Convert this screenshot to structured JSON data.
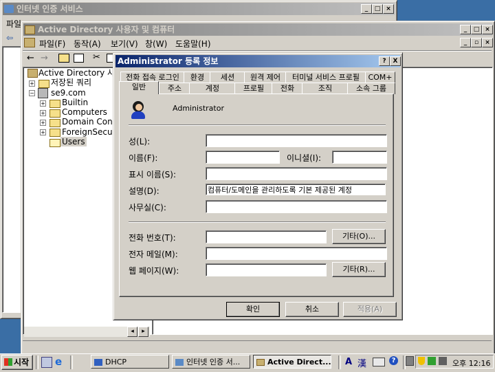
{
  "bg_window": {
    "title": "인터넷 인증 서비스",
    "menu_visible": "파일"
  },
  "main_window": {
    "title": "Active Directory 사용자 및 컴퓨터",
    "menu": [
      "파일(F)",
      "동작(A)",
      "보기(V)",
      "창(W)",
      "도움말(H)"
    ]
  },
  "tree": {
    "root": "Active Directory 사용자",
    "items": [
      "저장된 쿼리",
      "se9.com",
      "Builtin",
      "Computers",
      "Domain Contro",
      "ForeignSecurit",
      "Users"
    ]
  },
  "dialog": {
    "title": "Administrator 등록 정보",
    "help_btn": "?",
    "close_btn": "X",
    "tabs_back": [
      "전화 접속 로그인",
      "환경",
      "세션",
      "원격 제어",
      "터미널 서비스 프로필",
      "COM+"
    ],
    "tabs_front": [
      "일반",
      "주소",
      "계정",
      "프로필",
      "전화",
      "조직",
      "소속 그룹"
    ],
    "user_name": "Administrator",
    "fields": {
      "last_name": {
        "label": "성(L):",
        "value": ""
      },
      "first_name": {
        "label": "이름(F):",
        "value": ""
      },
      "initials": {
        "label": "이니셜(I):",
        "value": ""
      },
      "display_name": {
        "label": "표시 이름(S):",
        "value": ""
      },
      "description": {
        "label": "설명(D):",
        "value": "컴퓨터/도메인을 관리하도록 기본 제공된 계정"
      },
      "office": {
        "label": "사무실(C):",
        "value": ""
      },
      "phone": {
        "label": "전화 번호(T):",
        "value": ""
      },
      "email": {
        "label": "전자 메일(M):",
        "value": ""
      },
      "webpage": {
        "label": "웹 페이지(W):",
        "value": ""
      }
    },
    "other_btn_1": "기타(O)...",
    "other_btn_2": "기타(R)...",
    "ok": "확인",
    "cancel": "취소",
    "apply": "적용(A)"
  },
  "taskbar": {
    "start": "시작",
    "tasks": [
      "DHCP",
      "인터넷 인증 서...",
      "Active Direct..."
    ],
    "ime_a": "A",
    "ime_han": "漢",
    "clock": "오후 12:16"
  }
}
